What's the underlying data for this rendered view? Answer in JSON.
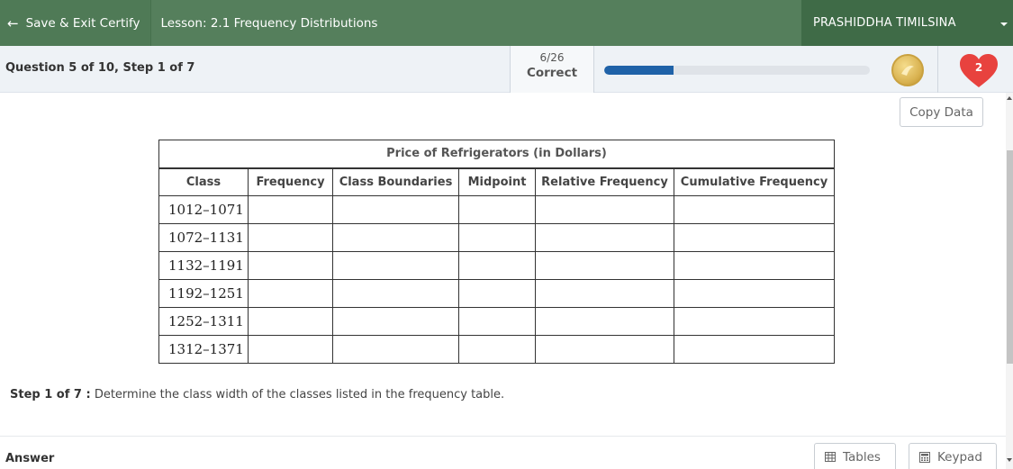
{
  "topbar": {
    "save_exit_label": "Save & Exit Certify",
    "lesson_title": "Lesson: 2.1 Frequency Distributions",
    "user_name": "PRASHIDDHA TIMILSINA"
  },
  "question_bar": {
    "question_info": "Question 5 of 10, Step 1 of 7",
    "score_count": "6/26",
    "score_label": "Correct",
    "progress_fraction": 0.26,
    "lives": "2"
  },
  "content": {
    "copy_data_label": "Copy Data",
    "table": {
      "title": "Price of Refrigerators (in Dollars)",
      "headers": [
        "Class",
        "Frequency",
        "Class Boundaries",
        "Midpoint",
        "Relative Frequency",
        "Cumulative Frequency"
      ],
      "classes": [
        "1012–1071",
        "1072–1131",
        "1132–1191",
        "1192–1251",
        "1252–1311",
        "1312–1371"
      ]
    },
    "step_label": "Step 1 of 7 :",
    "step_instruction": " Determine the class width of the classes listed in the frequency table."
  },
  "answer": {
    "label": "Answer",
    "tables_label": "Tables",
    "keypad_label": "Keypad"
  },
  "colors": {
    "topbar": "#557f5c",
    "progress_fill": "#1f62a8",
    "heart": "#e8423e"
  }
}
